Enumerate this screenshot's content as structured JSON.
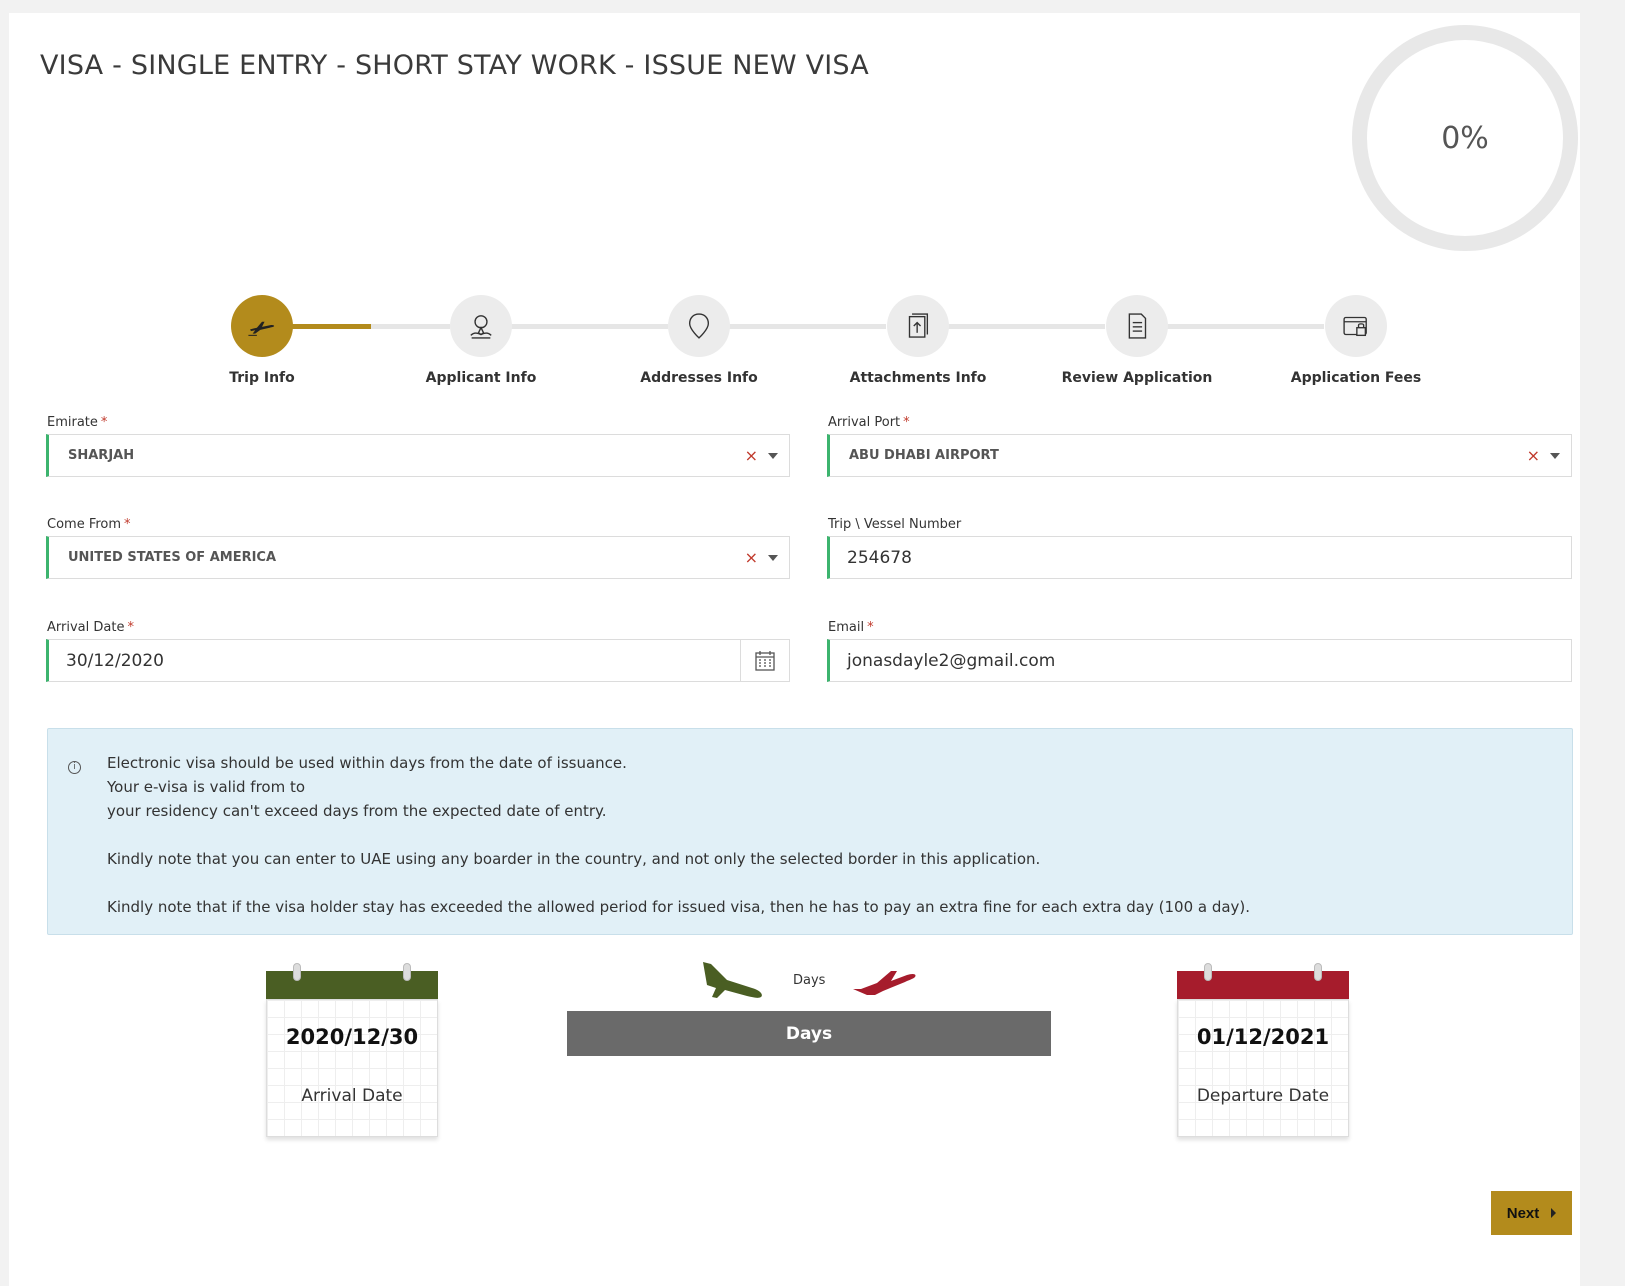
{
  "page": {
    "title": "VISA - SINGLE ENTRY - SHORT STAY WORK - ISSUE NEW VISA",
    "progress": "0%",
    "accent_color": "#b38b1c"
  },
  "steps": [
    {
      "label": "Trip Info",
      "icon": "airplane-icon",
      "active": true
    },
    {
      "label": "Applicant Info",
      "icon": "person-location-icon",
      "active": false
    },
    {
      "label": "Addresses Info",
      "icon": "map-pin-icon",
      "active": false
    },
    {
      "label": "Attachments Info",
      "icon": "upload-document-icon",
      "active": false
    },
    {
      "label": "Review Application",
      "icon": "document-list-icon",
      "active": false
    },
    {
      "label": "Application Fees",
      "icon": "payment-lock-icon",
      "active": false
    }
  ],
  "form": {
    "emirate": {
      "label": "Emirate",
      "value": "SHARJAH",
      "required": "*"
    },
    "arrival_port": {
      "label": "Arrival Port",
      "value": "ABU DHABI AIRPORT",
      "required": "*"
    },
    "come_from": {
      "label": "Come From",
      "value": "UNITED STATES OF AMERICA",
      "required": "*"
    },
    "trip_vessel": {
      "label": "Trip \\ Vessel Number",
      "value": "254678"
    },
    "arrival_date": {
      "label": "Arrival Date",
      "value": "30/12/2020",
      "required": "*"
    },
    "email": {
      "label": "Email",
      "value": "jonasdayle2@gmail.com",
      "required": "*"
    },
    "clear_glyph": "×"
  },
  "info": {
    "icon_glyph": "i",
    "line1": "Electronic visa should be used within days from the date of issuance.",
    "line2": "Your e-visa is valid from to",
    "line3": "your residency can't exceed days from the expected date of entry.",
    "line4": "Kindly note that you can enter to UAE using any boarder in the country, and not only the selected border in this application.",
    "line5": "Kindly note that if the visa holder stay has exceeded the allowed period for issued visa, then he has to pay an extra fine for each extra day (100 a day)."
  },
  "duration": {
    "arrival": {
      "date": "2020/12/30",
      "caption": "Arrival Date",
      "color": "#4a5e23"
    },
    "departure": {
      "date": "01/12/2021",
      "caption": "Departure Date",
      "color": "#a61c2c"
    },
    "days_small": "Days",
    "days_bar": "Days",
    "landing_color": "#4a5e23",
    "takeoff_color": "#a61c2c"
  },
  "actions": {
    "next_label": "Next"
  }
}
